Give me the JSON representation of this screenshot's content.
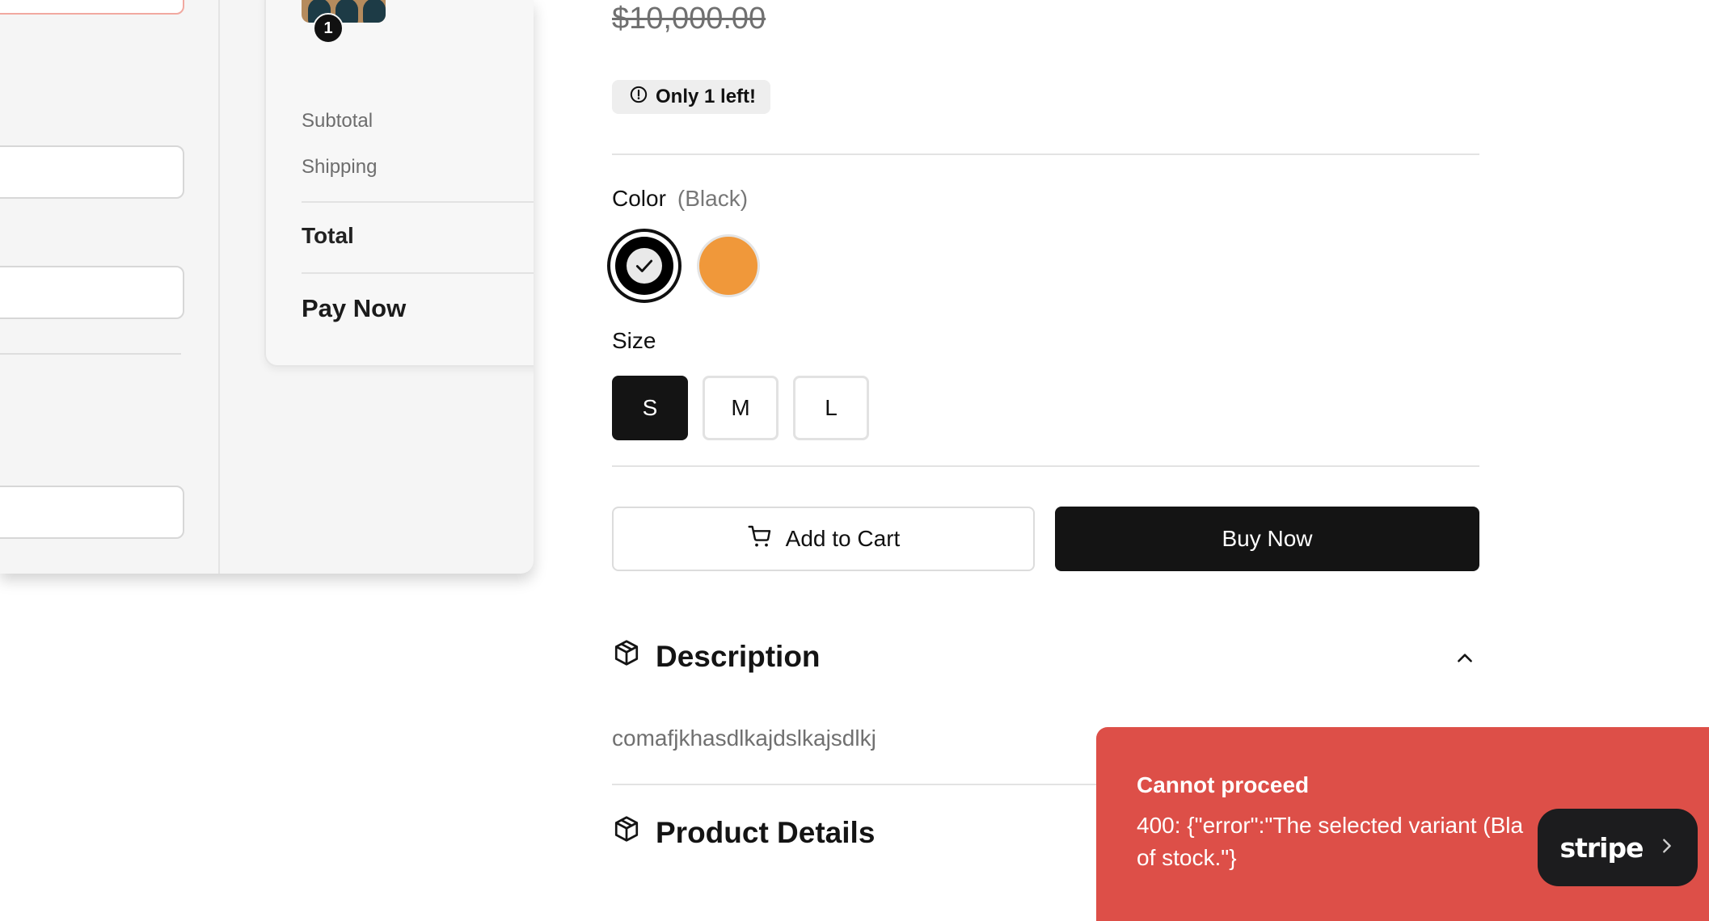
{
  "checkout": {
    "qty_badge": "1",
    "subtotal_label": "Subtotal",
    "shipping_label": "Shipping",
    "total_label": "Total",
    "pay_now_label": "Pay Now"
  },
  "product": {
    "price_original": "$10,000.00",
    "stock_badge": "Only 1 left!",
    "color_label": "Color",
    "color_selected": "(Black)",
    "colors": [
      {
        "name": "Black",
        "hex": "#000000",
        "selected": true
      },
      {
        "name": "Orange",
        "hex": "#f0983a",
        "selected": false
      }
    ],
    "size_label": "Size",
    "sizes": [
      {
        "label": "S",
        "selected": true
      },
      {
        "label": "M",
        "selected": false
      },
      {
        "label": "L",
        "selected": false
      }
    ],
    "add_to_cart_label": "Add to Cart",
    "buy_now_label": "Buy Now",
    "description_heading": "Description",
    "description_text": "comafjkhasdlkajdslkajsdlkj",
    "details_heading": "Product Details"
  },
  "toast": {
    "title": "Cannot proceed",
    "message": "400: {\"error\":\"The selected variant (Bla\nof stock.\"}",
    "color": "#dd4f48"
  },
  "badge": {
    "brand": "stripe"
  }
}
